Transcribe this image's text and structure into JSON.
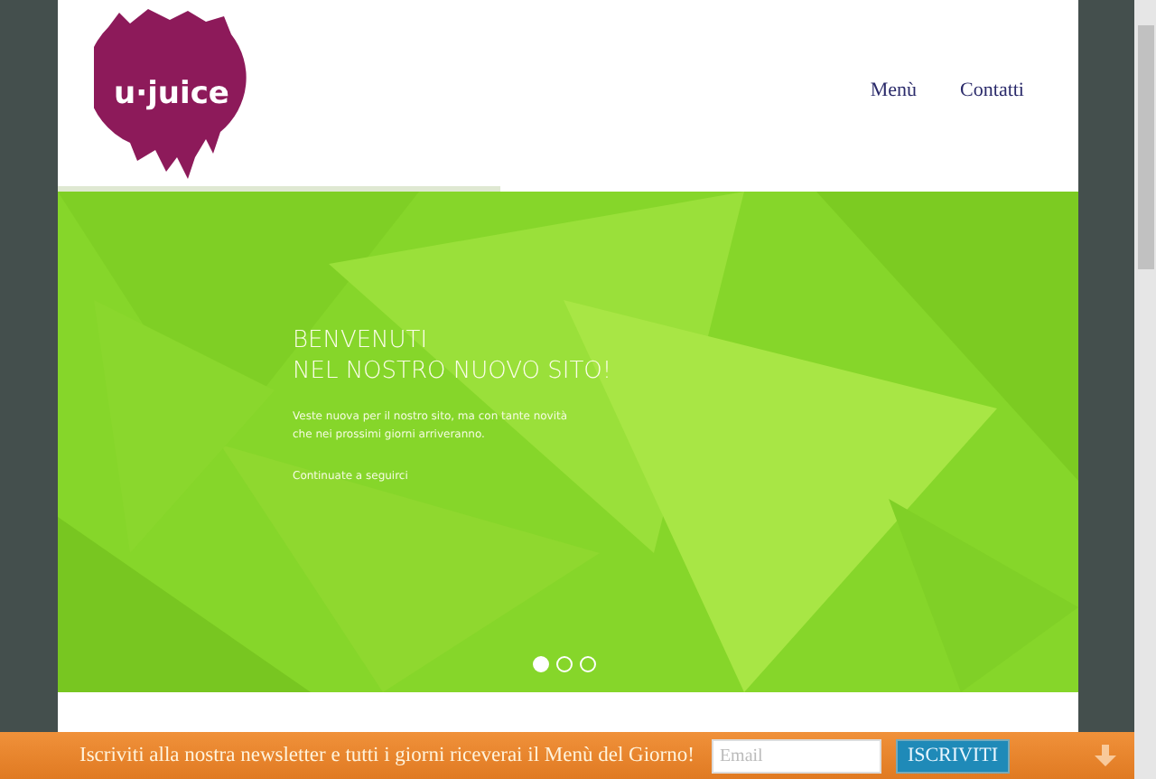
{
  "logo": {
    "text": "u·juice"
  },
  "nav": [
    {
      "label": "Menù"
    },
    {
      "label": "Contatti"
    }
  ],
  "hero": {
    "title_lines": [
      "BENVENUTI",
      "NEL NOSTRO NUOVO SITO!"
    ],
    "text_lines": [
      "Veste nuova per il nostro sito, ma con tante novità",
      "che nei prossimi giorni arriveranno."
    ],
    "link": "Continuate a seguirci",
    "dots": [
      {
        "selected": true
      },
      {
        "selected": false
      },
      {
        "selected": false
      }
    ]
  },
  "newsletter": {
    "text": "Iscriviti alla nostra newsletter e tutti i giorni riceverai il Menù del Giorno!",
    "placeholder": "Email",
    "button": "ISCRIVITI"
  }
}
